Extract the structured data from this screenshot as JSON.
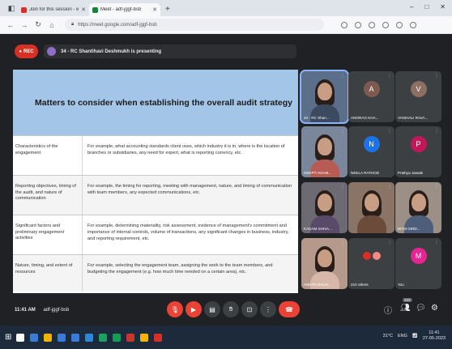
{
  "browser": {
    "tabs": [
      {
        "title": "Join for this session - whaatsMfix",
        "active": false,
        "favicon_color": "#d93025"
      },
      {
        "title": "Meet - adf-jggf-bsb",
        "active": true,
        "favicon_color": "#188038"
      }
    ],
    "new_tab": "+",
    "url": "https://meet.google.com/adf-jggf-bsb",
    "window_controls": [
      "–",
      "□",
      "✕"
    ]
  },
  "meet": {
    "rec_label": "REC",
    "presenting_text": "34 - RC Shantihavi Deshmukh is presenting",
    "slide": {
      "title": "Matters to consider when establishing the overall audit strategy",
      "rows": [
        {
          "label": "Characteristics of the engagement",
          "text": "For example, what accounting standards client uses, which industry it is in, where is the location of branches or subsidiaries, any need for expert, what is reporting currency, etc."
        },
        {
          "label": "Reporting objectives, timing of the audit, and nature of communication",
          "text": "For example, the timing for reporting, meeting with management, nature, and timing of communication with team members, any expected communications, etc."
        },
        {
          "label": "Significant factors and preliminary engagement activities",
          "text": "For example, determining materiality, risk assessment, evidence of management's commitment and importance of internal controls, volume of transactions, any significant changes in business, industry, and reporting requirement, etc."
        },
        {
          "label": "Nature, timing, and extent of resources",
          "text": "For example, selecting the engagement team, assigning the work to the team members, and budgeting the engagement (e.g. how much time needed on a certain area), etc."
        }
      ]
    },
    "participants": [
      {
        "name": "34 - RC Shan...",
        "kind": "video",
        "colors": {
          "bg": "#5b6e8a",
          "body": "#3b4a60"
        }
      },
      {
        "name": "ANORAG KHA...",
        "kind": "avatar",
        "initial": "A",
        "colors": {
          "bg": "#3c4043",
          "avatar": "#7c5b4e"
        }
      },
      {
        "name": "VAISHALI RAVA...",
        "kind": "avatar",
        "initial": "V",
        "colors": {
          "bg": "#3c4043",
          "avatar": "#8d6e63"
        }
      },
      {
        "name": "DEEPTI KHAB...",
        "kind": "video",
        "colors": {
          "bg": "#7a8699",
          "body": "#b85b54"
        }
      },
      {
        "name": "NEELA RATHOD",
        "kind": "avatar",
        "initial": "N",
        "colors": {
          "bg": "#3c4043",
          "avatar": "#1a73e8"
        }
      },
      {
        "name": "Prathya Jawale",
        "kind": "avatar",
        "initial": "P",
        "colors": {
          "bg": "#3c4043",
          "avatar": "#c2185b"
        }
      },
      {
        "name": "KADAM SHIVA...",
        "kind": "video",
        "colors": {
          "bg": "#6d6a73",
          "body": "#5a4a6a"
        }
      },
      {
        "name": "",
        "kind": "video",
        "colors": {
          "bg": "#8a7466",
          "body": "#6b4c3b"
        }
      },
      {
        "name": "BITM GIRD...",
        "kind": "video",
        "colors": {
          "bg": "#9c8f86",
          "body": "#4d5e7a"
        }
      },
      {
        "name": "ANKITA BALW...",
        "kind": "video",
        "colors": {
          "bg": "#b59a8c",
          "body": "#d7b7a8"
        }
      },
      {
        "name": "210 others",
        "kind": "others",
        "colors": {
          "bg": "#3c4043",
          "dot1": "#d93025",
          "dot2": "#f28b82"
        }
      },
      {
        "name": "You",
        "kind": "avatar",
        "initial": "M",
        "colors": {
          "bg": "#3c4043",
          "avatar": "#e52592"
        }
      }
    ],
    "clock": "11:41 AM",
    "meeting_code": "adf-jggf-bsb",
    "participants_badge": "223"
  },
  "taskbar": {
    "weather": "31°C",
    "tray_lang": "ENG",
    "time": "11:41",
    "date": "27-05-2023",
    "app_colors": [
      "#ffffff",
      "#3a7bd5",
      "#f2b400",
      "#3a7bd5",
      "#3a7bd5",
      "#2b88d8",
      "#1aa260",
      "#0f9d58",
      "#c7352b",
      "#f7b500",
      "#d93025"
    ]
  }
}
